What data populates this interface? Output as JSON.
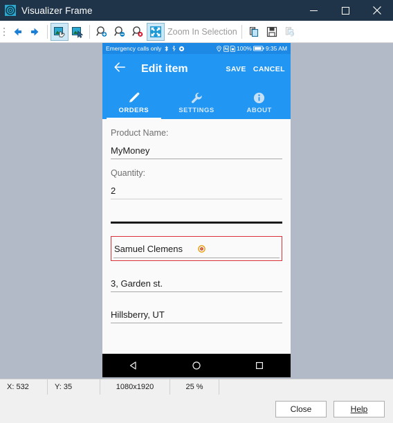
{
  "window": {
    "title": "Visualizer Frame",
    "app_icon": "gear-icon",
    "minimize_label": "Minimize",
    "maximize_label": "Maximize",
    "close_label": "Close"
  },
  "toolbar": {
    "items": [
      {
        "name": "back-icon",
        "label": "Back",
        "active": false
      },
      {
        "name": "forward-icon",
        "label": "Forward",
        "active": false
      },
      {
        "name": "pan-tool-icon",
        "label": "Pan",
        "active": true
      },
      {
        "name": "select-tool-icon",
        "label": "Select",
        "active": false
      },
      {
        "name": "zoom-in-icon",
        "label": "Zoom In",
        "active": false
      },
      {
        "name": "zoom-out-icon",
        "label": "Zoom Out",
        "active": false
      },
      {
        "name": "zoom-reset-icon",
        "label": "Zoom Reset",
        "active": false
      },
      {
        "name": "zoom-in-selection-icon",
        "label": "Zoom In Selection",
        "active": true
      },
      {
        "name": "copy-icon",
        "label": "Copy",
        "active": false
      },
      {
        "name": "save-icon",
        "label": "Save",
        "active": false
      },
      {
        "name": "refresh-icon",
        "label": "Refresh",
        "active": false
      }
    ],
    "zoom_in_selection_label": "Zoom In Selection"
  },
  "phone": {
    "status_bar": {
      "carrier_text": "Emergency calls only",
      "battery_percent": "100%",
      "clock": "9:35 AM",
      "left_icons": [
        "bluetooth-icon",
        "usb-icon",
        "settings-gear-icon"
      ],
      "right_icons": [
        "location-icon",
        "nfc-icon",
        "sim-icon",
        "battery-icon"
      ]
    },
    "app_bar": {
      "back_icon": "back-arrow-icon",
      "title": "Edit item",
      "save_label": "SAVE",
      "cancel_label": "CANCEL"
    },
    "tabs": [
      {
        "label": "ORDERS",
        "icon": "pencil-icon",
        "active": true
      },
      {
        "label": "SETTINGS",
        "icon": "wrench-icon",
        "active": false
      },
      {
        "label": "ABOUT",
        "icon": "info-icon",
        "active": false
      }
    ],
    "form": {
      "product_name_label": "Product Name:",
      "product_name_value": "MyMoney",
      "quantity_label": "Quantity:",
      "quantity_value": "2",
      "empty_field_value": "",
      "selected_field_value": "Samuel Clemens",
      "selected_marker_icon": "target-marker-icon",
      "address_line_value": "3, Garden st.",
      "city_state_value": "Hillsberry, UT"
    },
    "nav_bar": {
      "back": "nav-back-triangle-icon",
      "home": "nav-home-circle-icon",
      "recents": "nav-recents-square-icon"
    }
  },
  "status_strip": {
    "x_label": "X: 532",
    "y_label": "Y: 35",
    "resolution": "1080x1920",
    "zoom": "25 %",
    "extra": ""
  },
  "footer": {
    "close_label": "Close",
    "help_label": "Help",
    "help_accel": "H"
  },
  "colors": {
    "titlebar_bg": "#1f3349",
    "app_bar_blue": "#2196f3",
    "status_bar_blue": "#1e88e5",
    "canvas_bg": "#b3bac7",
    "selection_red": "#d9303a",
    "toolbar_active": "#cce8f7"
  }
}
